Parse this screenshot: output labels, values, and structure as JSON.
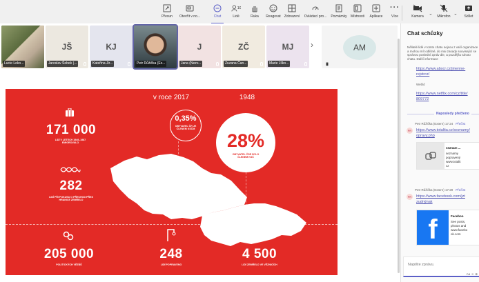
{
  "toolbar": {
    "items": [
      {
        "label": "Přesun",
        "icon": "move-icon"
      },
      {
        "label": "Otevřít v no...",
        "icon": "open-window-icon"
      },
      {
        "label": "Chat",
        "icon": "chat-icon"
      },
      {
        "label": "Lidé",
        "icon": "people-icon",
        "badge": "10"
      },
      {
        "label": "Ruka",
        "icon": "raise-hand-icon"
      },
      {
        "label": "Reagovat",
        "icon": "react-icon"
      },
      {
        "label": "Zobrazení",
        "icon": "view-icon"
      },
      {
        "label": "Ovládací pro...",
        "icon": "control-icon"
      },
      {
        "label": "Poznámky",
        "icon": "notes-icon"
      },
      {
        "label": "Místnosti",
        "icon": "rooms-icon"
      },
      {
        "label": "Aplikace",
        "icon": "apps-icon"
      },
      {
        "label": "Více",
        "icon": "more-icon"
      },
      {
        "label": "Kamera",
        "icon": "camera-icon"
      },
      {
        "label": "Mikrofon",
        "icon": "mic-icon"
      },
      {
        "label": "Sdílet",
        "icon": "share-icon"
      }
    ]
  },
  "participants": [
    {
      "initials": "",
      "name": "Lucie Leko...",
      "photo": true
    },
    {
      "initials": "JŠ",
      "name": "Jaroslav Šebek (...",
      "photo": false
    },
    {
      "initials": "KJ",
      "name": "Kateřina Jir...",
      "photo": false
    },
    {
      "initials": "",
      "name": "Petr Růžička (Ex...",
      "photo": true
    },
    {
      "initials": "J",
      "name": "Jana (Nezv...",
      "photo": false
    },
    {
      "initials": "ZČ",
      "name": "Zuzana Čan...",
      "photo": false
    },
    {
      "initials": "MJ",
      "name": "Marie Jílko...",
      "photo": false
    },
    {
      "initials": "AM",
      "name": "",
      "photo": false
    }
  ],
  "slide": {
    "year_2017": "v roce 2017",
    "year_1948": "1948",
    "pct_small": "0,35%",
    "pct_small_text": "OBYVATEL ČR JE ČLENEM KSČM",
    "pct_big": "28%",
    "pct_big_text": "OBYVATEL ČSR BYLO ČLENEM KSČ",
    "stat1_value": "171 000",
    "stat1_text": "LIDÍ V LETECH 1949–1987 EMIGROVALO",
    "stat2_value": "282",
    "stat2_text": "LIDÍ PŘI POKUSU O PŘECHOD PŘES HRANICE ZEMŘELO",
    "stat3_value": "205 000",
    "stat3_text": "POLITICKÝCH VĚZŇŮ",
    "stat4_value": "248",
    "stat4_text": "LIDÍ POPRAVENO",
    "stat5_value": "4 500",
    "stat5_text": "LIDÍ ZEMŘELO VE VĚZNICÍCH"
  },
  "chat": {
    "title": "Chat schůzky",
    "notice": "Nělitelé lidé v tomto chatu nejsou z vaší organizace a mohou mít odlišné, do mai zasady související se správou poslední zpráv dle, a pozdějšu tuhoto chatu. Další informace",
    "link1": "https://www.abscr.cz/jmenne-",
    "link1b": "rejstrcz/",
    "label_webid": "Webld",
    "link2": "https://www.netflix.com/cz/title/",
    "link2b": "809772",
    "new_divider": "Naposledy přečteno",
    "msg1_author": "Petr Růžička (Extern)",
    "msg1_time": "17:24",
    "msg1_reply": "Přečíst",
    "msg1_link": "https://www.totalita.cz/seznamy/",
    "msg1_link2": "opravy.php",
    "msg1_preview_title": "seznam ...",
    "msg1_preview_line1": "seznamy",
    "msg1_preview_line2": "popravený",
    "msg1_preview_line3": "www.totalit",
    "msg1_preview_line4": "cz",
    "msg2_author": "Petr Růžička (Extern)",
    "msg2_time": "17:29",
    "msg2_reply": "Přečíst",
    "msg2_link": "https://www.facebook.com/jzt",
    "msg2_link2": "zudnýnak",
    "msg2_preview_title": "Faceboo",
    "msg2_preview_line1": "See posts,",
    "msg2_preview_line2": "photos and",
    "msg2_preview_line3": "www.facebo",
    "msg2_preview_line4": "ok.com",
    "compose_placeholder": "Napište zprávu.",
    "compose_tools": "Aa ☺ ⊕"
  },
  "colors": {
    "slide_red": "#e32a26",
    "teams_purple": "#5b5fc7"
  }
}
